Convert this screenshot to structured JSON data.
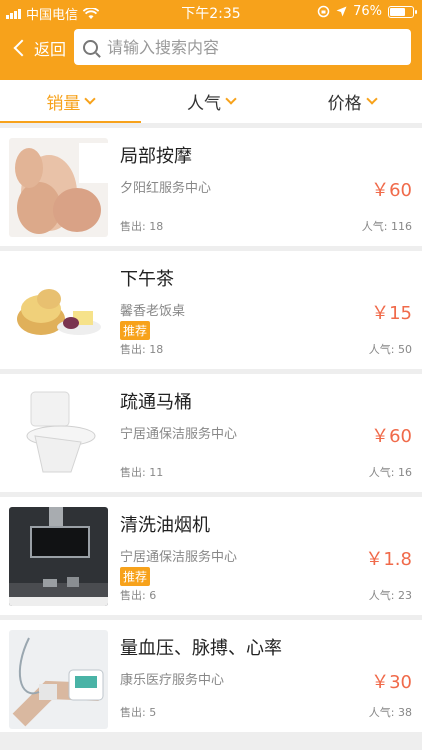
{
  "status": {
    "carrier": "中国电信",
    "time": "下午2:35",
    "battery": "76%",
    "battery_level": 0.76
  },
  "nav": {
    "back_label": "返回",
    "search_placeholder": "请输入搜索内容",
    "search_value": ""
  },
  "sort_tabs": [
    {
      "label": "销量",
      "active": true
    },
    {
      "label": "人气",
      "active": false
    },
    {
      "label": "价格",
      "active": false
    }
  ],
  "sold_prefix": "售出:",
  "pop_prefix": "人气:",
  "items": [
    {
      "title": "局部按摩",
      "shop": "夕阳红服务中心",
      "price": "￥60",
      "sold": "18",
      "popularity": "116",
      "tag": ""
    },
    {
      "title": "下午茶",
      "shop": "馨香老饭桌",
      "price": "￥15",
      "sold": "18",
      "popularity": "50",
      "tag": "推荐"
    },
    {
      "title": "疏通马桶",
      "shop": "宁居通保洁服务中心",
      "price": "￥60",
      "sold": "11",
      "popularity": "16",
      "tag": ""
    },
    {
      "title": "清洗油烟机",
      "shop": "宁居通保洁服务中心",
      "price": "￥1.8",
      "sold": "6",
      "popularity": "23",
      "tag": "推荐"
    },
    {
      "title": "量血压、脉搏、心率",
      "shop": "康乐医疗服务中心",
      "price": "￥30",
      "sold": "5",
      "popularity": "38",
      "tag": ""
    }
  ]
}
